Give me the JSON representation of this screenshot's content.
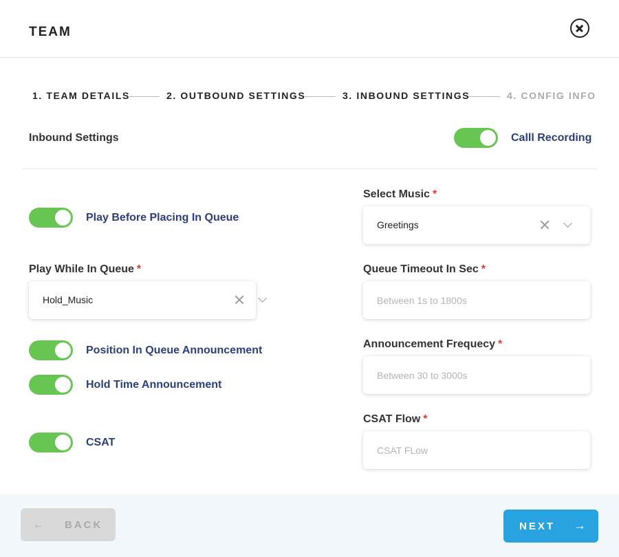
{
  "header": {
    "title": "TEAM",
    "close_icon": "close-circle-icon"
  },
  "stepper": {
    "steps": [
      {
        "label": "1. TEAM DETAILS",
        "state": "done"
      },
      {
        "label": "2. OUTBOUND SETTINGS",
        "state": "done"
      },
      {
        "label": "3. INBOUND SETTINGS",
        "state": "active"
      },
      {
        "label": "4. CONFIG INFO",
        "state": "inactive"
      }
    ]
  },
  "inbound": {
    "section_label": "Inbound Settings",
    "call_recording": {
      "label": "Calll Recording",
      "on": true
    }
  },
  "left": {
    "play_before": {
      "label": "Play Before Placing In Queue",
      "on": true
    },
    "play_while": {
      "label": "Play While In Queue",
      "required": "*",
      "value": "Hold_Music"
    },
    "position_announcement": {
      "label": "Position In Queue Announcement",
      "on": true
    },
    "hold_time_announcement": {
      "label": "Hold Time Announcement",
      "on": true
    },
    "csat": {
      "label": "CSAT",
      "on": true
    }
  },
  "right": {
    "select_music": {
      "label": "Select Music",
      "required": "*",
      "value": "Greetings"
    },
    "queue_timeout": {
      "label": "Queue Timeout In Sec",
      "required": "*",
      "placeholder": "Between 1s to 1800s",
      "value": ""
    },
    "announcement_frequency": {
      "label": "Announcement Frequecy",
      "required": "*",
      "placeholder": "Between 30 to 3000s",
      "value": ""
    },
    "csat_flow": {
      "label": "CSAT Flow",
      "required": "*",
      "placeholder": "CSAT FLow",
      "value": ""
    }
  },
  "footer": {
    "back_label": "BACK",
    "next_label": "NEXT",
    "back_enabled": false
  },
  "colors": {
    "toggle_on": "#67c652",
    "label_blue": "#2b3f7e",
    "required_red": "#e53935",
    "next_button": "#29a3e0",
    "back_button_disabled": "#d9d9d9",
    "footer_bg": "#f2f8fb"
  }
}
